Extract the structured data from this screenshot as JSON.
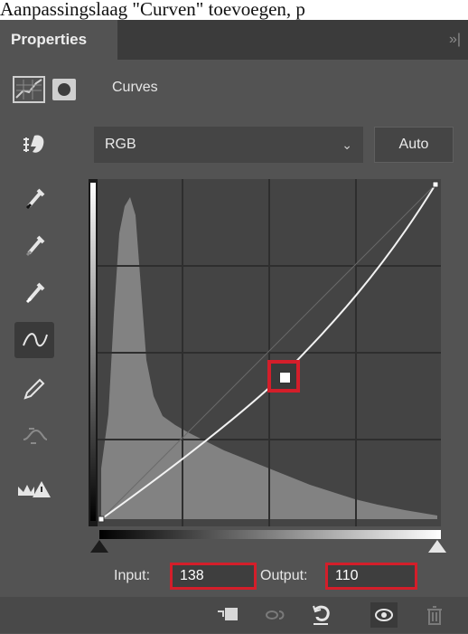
{
  "caption": "Aanpassingslaag \"Curven\" toevoegen, p",
  "panel": {
    "tab_label": "Properties",
    "collapse_label": "»|"
  },
  "adjustment": {
    "title": "Curves"
  },
  "controls": {
    "channel": "RGB",
    "auto_label": "Auto"
  },
  "tools": [
    {
      "name": "black-point-eyedropper-icon"
    },
    {
      "name": "gray-point-eyedropper-icon"
    },
    {
      "name": "white-point-eyedropper-icon"
    },
    {
      "name": "curve-points-tool-icon",
      "active": true
    },
    {
      "name": "pencil-icon"
    },
    {
      "name": "smooth-icon",
      "disabled": true
    },
    {
      "name": "clipping-warning-icon"
    }
  ],
  "curve": {
    "control_point": {
      "input": 138,
      "output": 110
    }
  },
  "io": {
    "input_label": "Input:",
    "input_value": "138",
    "output_label": "Output:",
    "output_value": "110"
  },
  "colors": {
    "panel_bg": "#535353",
    "graph_bg": "#444444",
    "highlight": "#d41e2a"
  },
  "footer": [
    {
      "name": "clip-to-layer-icon"
    },
    {
      "name": "view-previous-state-icon",
      "disabled": true
    },
    {
      "name": "reset-icon"
    },
    {
      "name": "visibility-eye-icon"
    },
    {
      "name": "delete-trash-icon"
    }
  ]
}
